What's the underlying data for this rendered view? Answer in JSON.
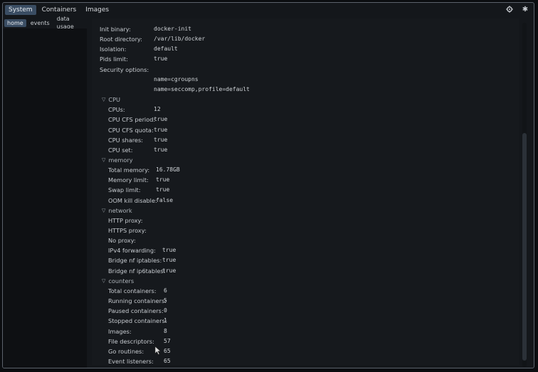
{
  "tabs": [
    "System",
    "Containers",
    "Images"
  ],
  "subtabs": [
    "home",
    "events",
    "data usage"
  ],
  "icons": [
    "gear-icon",
    "asterisk-icon"
  ],
  "general": [
    {
      "label": "Init binary:",
      "value": "docker-init"
    },
    {
      "label": "Root directory:",
      "value": "/var/lib/docker"
    },
    {
      "label": "Isolation:",
      "value": "default"
    },
    {
      "label": "Pids limit:",
      "value": "true"
    },
    {
      "label": "Security options:",
      "value": ""
    }
  ],
  "security_options": [
    "name=cgroupns",
    "name=seccomp,profile=default"
  ],
  "sections": {
    "cpu": {
      "title": "CPU",
      "rows": [
        {
          "label": "CPUs:",
          "value": "12"
        },
        {
          "label": "CPU CFS period:",
          "value": "true"
        },
        {
          "label": "CPU CFS quota:",
          "value": "true"
        },
        {
          "label": "CPU shares:",
          "value": "true"
        },
        {
          "label": "CPU set:",
          "value": "true"
        }
      ]
    },
    "memory": {
      "title": "memory",
      "rows": [
        {
          "label": "Total memory:",
          "value": "16.78GB"
        },
        {
          "label": "Memory limit:",
          "value": "true"
        },
        {
          "label": "Swap limit:",
          "value": "true"
        },
        {
          "label": "OOM kill disable:",
          "value": "false"
        }
      ]
    },
    "network": {
      "title": "network",
      "rows": [
        {
          "label": "HTTP proxy:",
          "value": ""
        },
        {
          "label": "HTTPS proxy:",
          "value": ""
        },
        {
          "label": "No proxy:",
          "value": ""
        },
        {
          "label": "IPv4 forwarding:",
          "value": "true"
        },
        {
          "label": "Bridge nf iptables:",
          "value": "true"
        },
        {
          "label": "Bridge nf ip6tables:",
          "value": "true"
        }
      ]
    },
    "counters": {
      "title": "counters",
      "rows": [
        {
          "label": "Total containers:",
          "value": "6"
        },
        {
          "label": "Running containers:",
          "value": "5"
        },
        {
          "label": "Paused containers:",
          "value": "0"
        },
        {
          "label": "Stopped containers:",
          "value": "1"
        },
        {
          "label": "Images:",
          "value": "8"
        },
        {
          "label": "File descriptors:",
          "value": "57"
        },
        {
          "label": "Go routines:",
          "value": "65"
        },
        {
          "label": "Event listeners:",
          "value": "65"
        }
      ]
    }
  },
  "colors": {
    "active_tab": "#3a4d63",
    "background": "#14171b",
    "content": "#16191d"
  }
}
